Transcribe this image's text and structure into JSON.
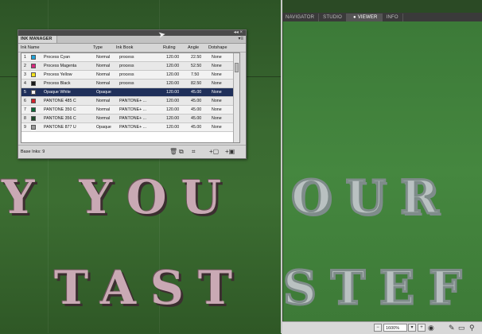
{
  "artwork": {
    "row1_left": "Y YOU",
    "row2_left": "TAST",
    "row1_right": "OUR",
    "row2_right": "STEF"
  },
  "viewer_panel": {
    "tabs": [
      {
        "label": "NAVIGATOR",
        "active": false
      },
      {
        "label": "STUDIO",
        "active": false
      },
      {
        "label": "VIEWER",
        "active": true
      },
      {
        "label": "INFO",
        "active": false
      }
    ],
    "zoom": "1600%"
  },
  "ink_manager": {
    "title": "INK MANAGER",
    "columns": [
      "Ink Name",
      "Type",
      "Ink Book",
      "Ruling",
      "Angle",
      "Dotshape"
    ],
    "rows": [
      {
        "num": "1",
        "color": "#1fa3d8",
        "name": "Process Cyan",
        "type": "Normal",
        "book": "process",
        "ruling": "120.00",
        "angle": "22.50",
        "dot": "None"
      },
      {
        "num": "2",
        "color": "#d6287e",
        "name": "Process Magenta",
        "type": "Normal",
        "book": "process",
        "ruling": "120.00",
        "angle": "52.50",
        "dot": "None"
      },
      {
        "num": "3",
        "color": "#f4e21c",
        "name": "Process Yellow",
        "type": "Normal",
        "book": "process",
        "ruling": "120.00",
        "angle": "7.50",
        "dot": "None"
      },
      {
        "num": "4",
        "color": "#1a1a1a",
        "name": "Process Black",
        "type": "Normal",
        "book": "process",
        "ruling": "120.00",
        "angle": "82.50",
        "dot": "None"
      },
      {
        "num": "5",
        "color": "#f3eef0",
        "name": "Opaque White",
        "type": "Opaque",
        "book": "",
        "ruling": "120.00",
        "angle": "45.00",
        "dot": "None"
      },
      {
        "num": "6",
        "color": "#d2242e",
        "name": "PANTONE 485 C",
        "type": "Normal",
        "book": "PANTONE+ ...",
        "ruling": "120.00",
        "angle": "45.00",
        "dot": "None"
      },
      {
        "num": "7",
        "color": "#0f6b3a",
        "name": "PANTONE 350 C",
        "type": "Normal",
        "book": "PANTONE+ ...",
        "ruling": "120.00",
        "angle": "45.00",
        "dot": "None"
      },
      {
        "num": "8",
        "color": "#1d4a2a",
        "name": "PANTONE 356 C",
        "type": "Normal",
        "book": "PANTONE+ ...",
        "ruling": "120.00",
        "angle": "45.00",
        "dot": "None"
      },
      {
        "num": "9",
        "color": "#9a9a9a",
        "name": "PANTONE 877 U",
        "type": "Opaque",
        "book": "PANTONE+ ...",
        "ruling": "120.00",
        "angle": "45.00",
        "dot": "None"
      }
    ],
    "selected_row": 4,
    "footer_count": "Base Inks: 9"
  }
}
